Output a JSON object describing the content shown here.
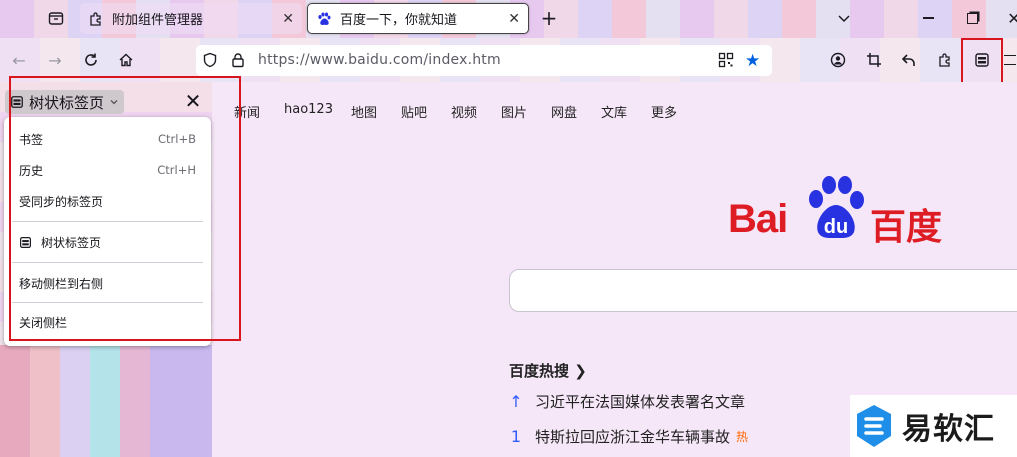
{
  "tabs": [
    {
      "title": "附加组件管理器",
      "icon": "puzzle-icon",
      "active": false
    },
    {
      "title": "百度一下，你就知道",
      "icon": "baidu-paw-icon",
      "active": true
    }
  ],
  "address_bar": {
    "url": "https://www.baidu.com/index.htm"
  },
  "sidebar": {
    "switcher_label": "树状标签页",
    "menu": [
      {
        "label": "书签",
        "shortcut": "Ctrl+B"
      },
      {
        "label": "历史",
        "shortcut": "Ctrl+H"
      },
      {
        "label": "受同步的标签页",
        "shortcut": ""
      },
      {
        "label": "树状标签页",
        "shortcut": ""
      },
      {
        "label": "移动侧栏到右侧",
        "shortcut": ""
      },
      {
        "label": "关闭侧栏",
        "shortcut": ""
      }
    ]
  },
  "baidu": {
    "nav_links": [
      "新闻",
      "hao123",
      "地图",
      "贴吧",
      "视频",
      "图片",
      "网盘",
      "文库",
      "更多"
    ],
    "logo_text_left": "Bai",
    "logo_text_mid": "du",
    "logo_text_right": "百度",
    "hot_title": "百度热搜",
    "hot_items": [
      {
        "rank": "↑",
        "text": "习近平在法国媒体发表署名文章"
      },
      {
        "rank": "1",
        "text": "特斯拉回应浙江金华车辆事故",
        "badge": "热"
      }
    ]
  },
  "watermark": {
    "text": "易软汇"
  },
  "colors": {
    "highlight": "#d8141d",
    "baidu_red": "#de1c23",
    "baidu_blue": "#2932e1",
    "star": "#0061e0"
  }
}
